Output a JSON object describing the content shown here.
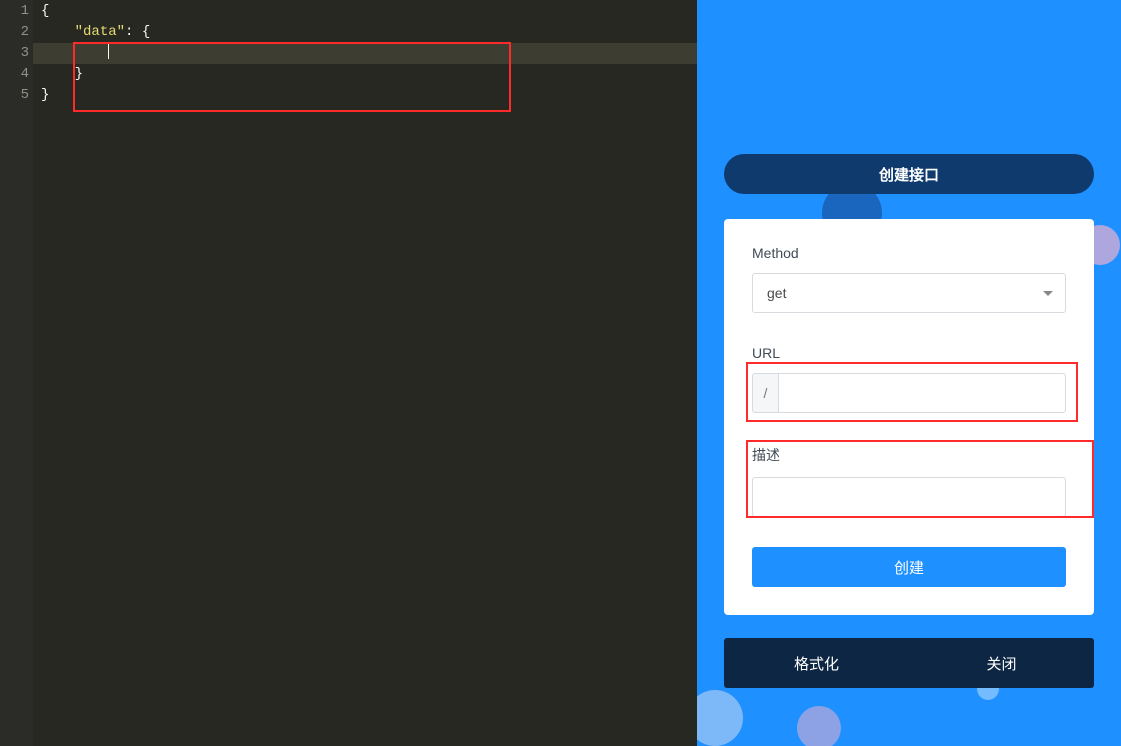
{
  "editor": {
    "line_numbers": [
      "1",
      "2",
      "3",
      "4",
      "5"
    ],
    "lines": {
      "l1_brace_open": "{",
      "l2_indent": "    ",
      "l2_key": "\"data\"",
      "l2_after": ": {",
      "l3_indent": "        ",
      "l4_indent": "    ",
      "l4_brace_close": "}",
      "l5_brace_close": "}"
    }
  },
  "panel": {
    "header": "创建接口",
    "method_label": "Method",
    "method_value": "get",
    "url_label": "URL",
    "url_prefix": "/",
    "url_value": "",
    "desc_label": "描述",
    "desc_value": "",
    "create_label": "创建",
    "footer_format": "格式化",
    "footer_close": "关闭"
  }
}
